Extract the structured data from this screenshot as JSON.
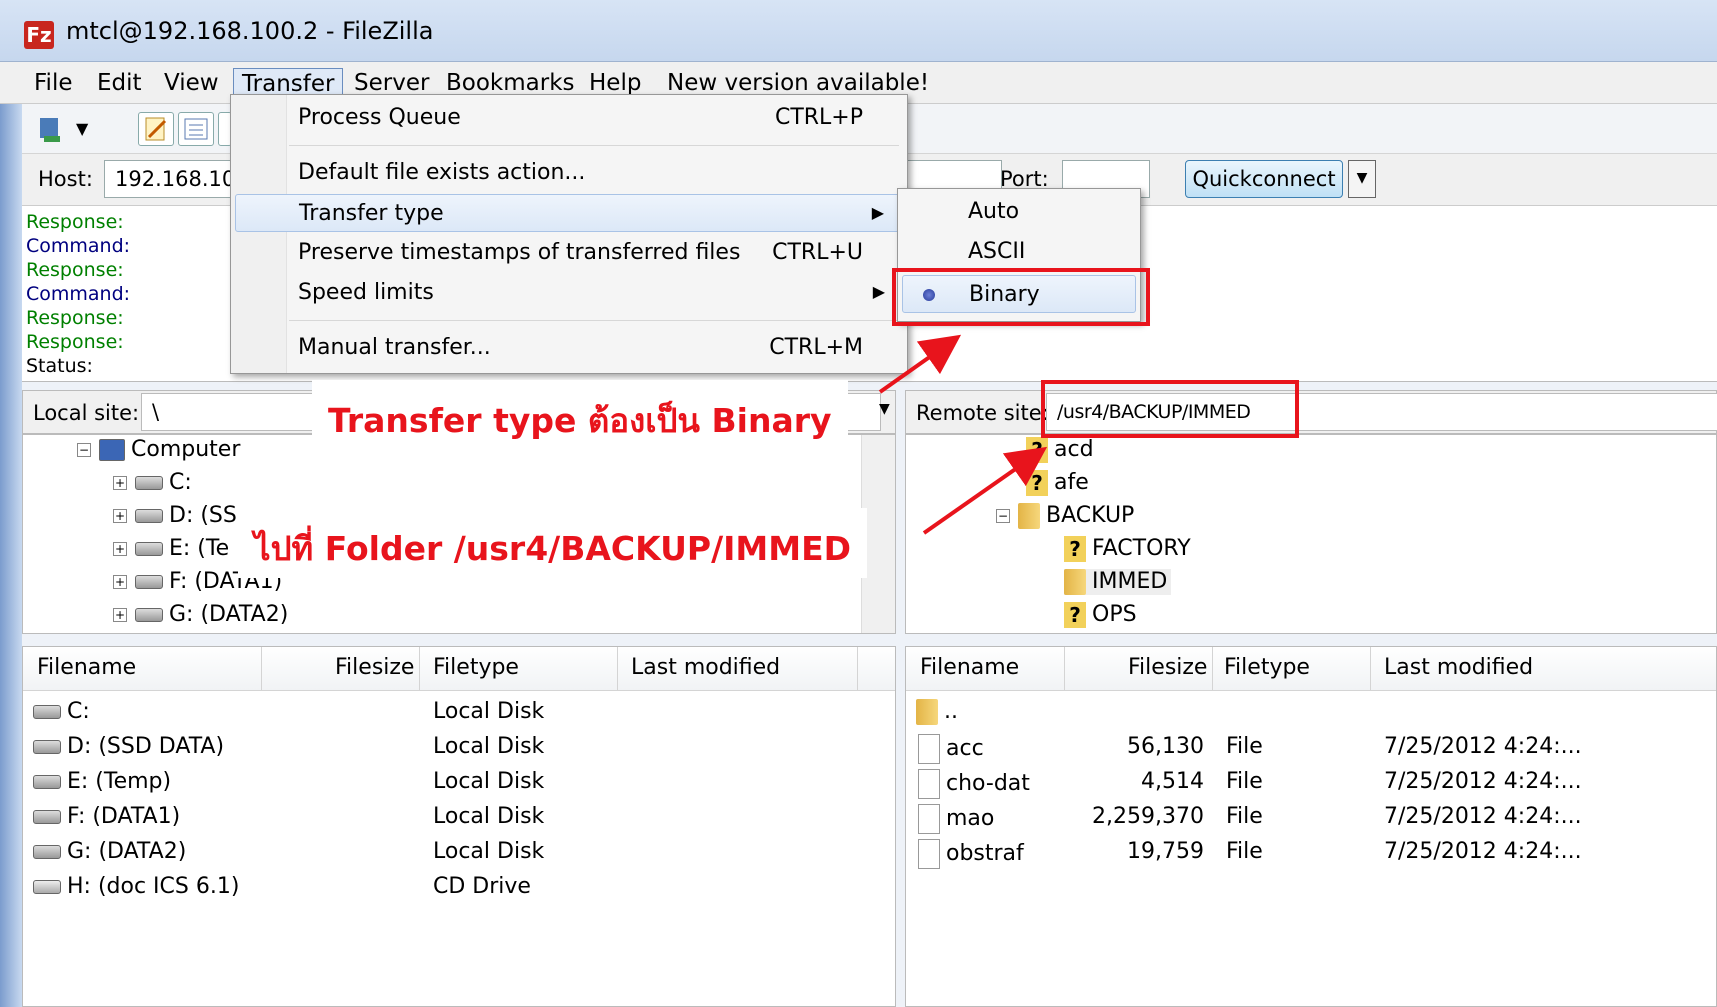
{
  "window": {
    "title": "mtcl@192.168.100.2 - FileZilla",
    "icon": "Fz"
  },
  "menubar": [
    "File",
    "Edit",
    "View",
    "Transfer",
    "Server",
    "Bookmarks",
    "Help",
    "New version available!"
  ],
  "quickconnect": {
    "host_label": "Host:",
    "host_value": "192.168.10",
    "port_label": "Port:",
    "port_value": "",
    "button": "Quickconnect"
  },
  "log": [
    {
      "type": "Response:",
      "kind": "response"
    },
    {
      "type": "Command:",
      "kind": "command"
    },
    {
      "type": "Response:",
      "kind": "response"
    },
    {
      "type": "Command:",
      "kind": "command"
    },
    {
      "type": "Response:",
      "kind": "response"
    },
    {
      "type": "Response:",
      "kind": "response"
    },
    {
      "type": "Status:",
      "kind": "status"
    }
  ],
  "transfer_menu": {
    "items": [
      {
        "label": "Process Queue",
        "shortcut": "CTRL+P"
      },
      {
        "label": "Default file exists action...",
        "shortcut": ""
      },
      {
        "label": "Transfer type",
        "shortcut": "",
        "submenu": true
      },
      {
        "label": "Preserve timestamps of transferred files",
        "shortcut": "CTRL+U"
      },
      {
        "label": "Speed limits",
        "shortcut": "",
        "submenu": true
      },
      {
        "label": "Manual transfer...",
        "shortcut": "CTRL+M"
      }
    ],
    "submenu": {
      "items": [
        "Auto",
        "ASCII",
        "Binary"
      ],
      "selected": "Binary"
    }
  },
  "local": {
    "site_label": "Local site:",
    "site_value": "\\",
    "tree": {
      "computer": "Computer",
      "drives": [
        "C:",
        "D: (SS",
        "E: (Te",
        "F: (DATA1)",
        "G: (DATA2)"
      ]
    },
    "headers": [
      "Filename",
      "Filesize",
      "Filetype",
      "Last modified"
    ],
    "files": [
      {
        "name": "C:",
        "type": "Local Disk"
      },
      {
        "name": "D: (SSD DATA)",
        "type": "Local Disk"
      },
      {
        "name": "E: (Temp)",
        "type": "Local Disk"
      },
      {
        "name": "F: (DATA1)",
        "type": "Local Disk"
      },
      {
        "name": "G: (DATA2)",
        "type": "Local Disk"
      },
      {
        "name": "H: (doc ICS 6.1)",
        "type": "CD Drive"
      }
    ]
  },
  "remote": {
    "site_label": "Remote site:",
    "site_value": "/usr4/BACKUP/IMMED",
    "tree": [
      "acd",
      "afe",
      "BACKUP",
      "FACTORY",
      "IMMED",
      "OPS"
    ],
    "headers": [
      "Filename",
      "Filesize",
      "Filetype",
      "Last modified"
    ],
    "files": [
      {
        "name": "..",
        "size": "",
        "type": "",
        "modified": ""
      },
      {
        "name": "acc",
        "size": "56,130",
        "type": "File",
        "modified": "7/25/2012 4:24:..."
      },
      {
        "name": "cho-dat",
        "size": "4,514",
        "type": "File",
        "modified": "7/25/2012 4:24:..."
      },
      {
        "name": "mao",
        "size": "2,259,370",
        "type": "File",
        "modified": "7/25/2012 4:24:..."
      },
      {
        "name": "obstraf",
        "size": "19,759",
        "type": "File",
        "modified": "7/25/2012 4:24:..."
      }
    ]
  },
  "annotations": {
    "transfer_type": "Transfer type ต้องเป็น Binary",
    "folder": "ไปที่ Folder /usr4/BACKUP/IMMED",
    "color": "#e8141c"
  }
}
